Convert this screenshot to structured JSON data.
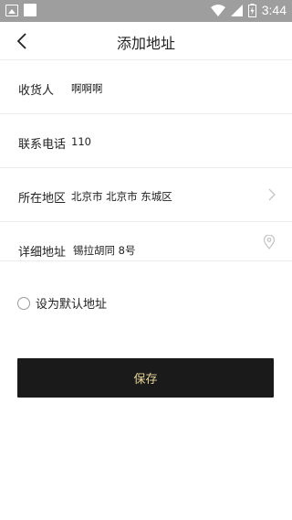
{
  "status_bar": {
    "time": "3:44",
    "icons": [
      "image-icon",
      "notification-square-icon",
      "wifi-icon",
      "signal-icon",
      "battery-charging-icon"
    ]
  },
  "header": {
    "title": "添加地址",
    "back_icon": "chevron-left-icon"
  },
  "form": {
    "receiver": {
      "label": "收货人",
      "value": "啊啊啊"
    },
    "phone": {
      "label": "联系电话",
      "value": "110"
    },
    "region": {
      "label": "所在地区",
      "value": "北京市 北京市 东城区",
      "icon": "chevron-right-icon"
    },
    "address": {
      "label": "详细地址",
      "value": "锡拉胡同 8号",
      "icon": "location-pin-icon"
    }
  },
  "default_option": {
    "label": "设为默认地址",
    "checked": false
  },
  "save_button": {
    "label": "保存"
  },
  "colors": {
    "status_bar": "#9e9e9e",
    "button_bg": "#1a1a1a",
    "button_text": "#e8d79a",
    "divider": "#ececec"
  }
}
